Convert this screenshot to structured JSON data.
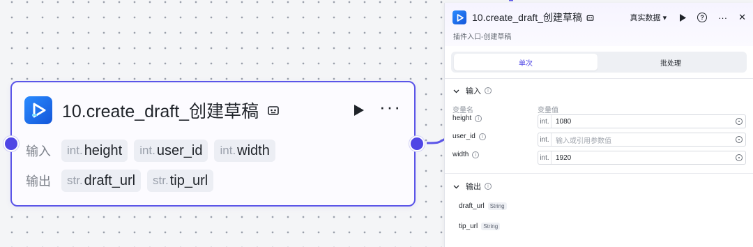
{
  "node": {
    "title": "10.create_draft_创建草稿",
    "input_label": "输入",
    "output_label": "输出",
    "inputs": [
      {
        "type": "int.",
        "name": "height"
      },
      {
        "type": "int.",
        "name": "user_id"
      },
      {
        "type": "int.",
        "name": "width"
      }
    ],
    "outputs": [
      {
        "type": "str.",
        "name": "draft_url"
      },
      {
        "type": "str.",
        "name": "tip_url"
      }
    ],
    "more_label": "···"
  },
  "panel": {
    "title": "10.create_draft_创建草稿",
    "mode_label": "真实数据 ▾",
    "subtitle": "插件入口-创建草稿",
    "tabs": [
      "单次",
      "批处理"
    ],
    "active_tab": "单次",
    "input_section": "输入",
    "col_name": "变量名",
    "col_value": "变量值",
    "inputs": [
      {
        "name": "height",
        "type": "int.",
        "value": "1080",
        "placeholder": ""
      },
      {
        "name": "user_id",
        "type": "int.",
        "value": "",
        "placeholder": "输入或引用参数值"
      },
      {
        "name": "width",
        "type": "int.",
        "value": "1920",
        "placeholder": ""
      }
    ],
    "output_section": "输出",
    "outputs": [
      {
        "name": "draft_url",
        "type": "String"
      },
      {
        "name": "tip_url",
        "type": "String"
      }
    ],
    "help_icon": "?",
    "more_icon": "···",
    "close_icon": "✕"
  },
  "colors": {
    "accent": "#4f46e5",
    "brand": "#1e6fff"
  }
}
